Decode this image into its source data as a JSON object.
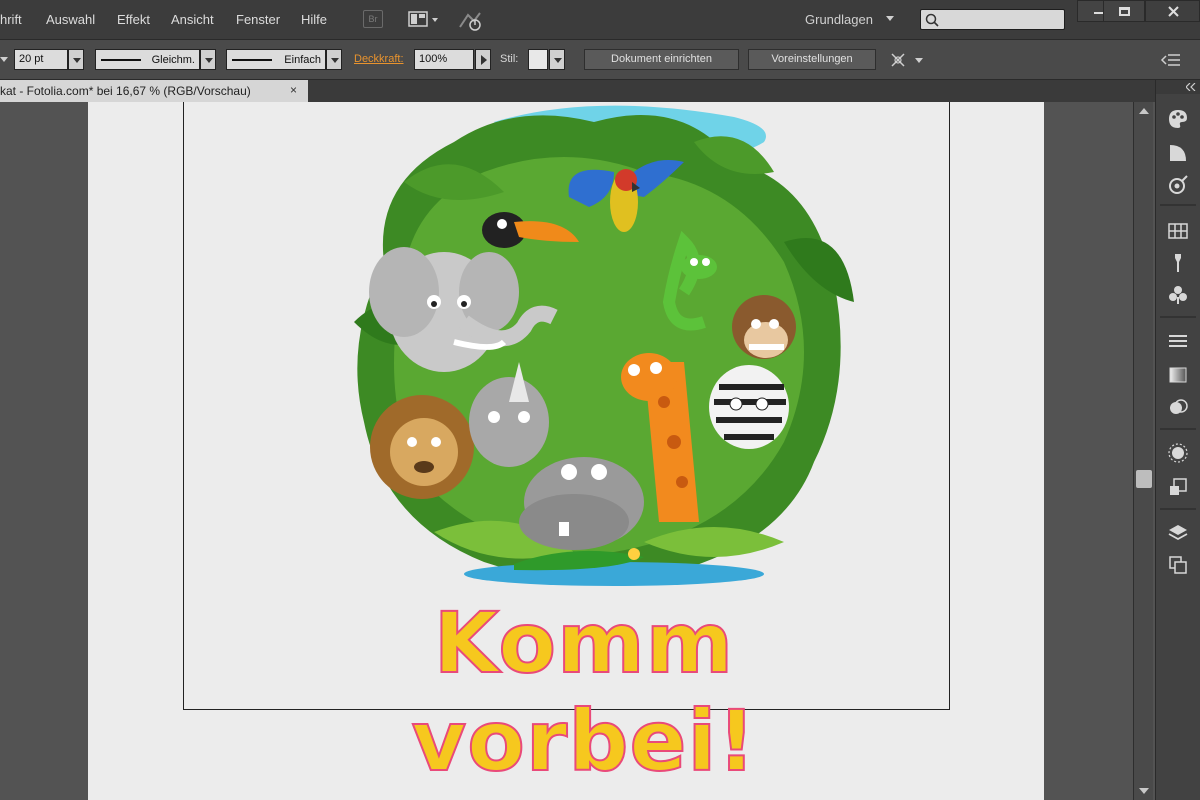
{
  "menu": {
    "items": [
      "hrift",
      "Auswahl",
      "Effekt",
      "Ansicht",
      "Fenster",
      "Hilfe"
    ],
    "bridge_label": "Br",
    "workspace": "Grundlagen"
  },
  "control": {
    "stroke_size": "20 pt",
    "stroke_profile": "Gleichm.",
    "brush": "Einfach",
    "opacity_label": "Deckkraft:",
    "opacity_value": "100%",
    "style_label": "Stil:",
    "doc_setup_button": "Dokument einrichten",
    "prefs_button": "Voreinstellungen"
  },
  "document": {
    "tab_title": "kat - Fotolia.com* bei 16,67 % (RGB/Vorschau)",
    "tab_close": "×",
    "headline": "Komm vorbei!"
  },
  "colors": {
    "headline_fill": "#f6c81e",
    "headline_stroke": "#e94a7a",
    "link_orange": "#e8932e"
  },
  "panel_icons": [
    "color-icon",
    "color-guide-icon",
    "recolor-icon",
    "swatches-icon",
    "brushes-icon",
    "symbols-icon",
    "stroke-icon",
    "gradient-icon",
    "transparency-icon",
    "appearance-icon",
    "graphic-styles-icon",
    "layers-icon",
    "artboards-icon"
  ]
}
